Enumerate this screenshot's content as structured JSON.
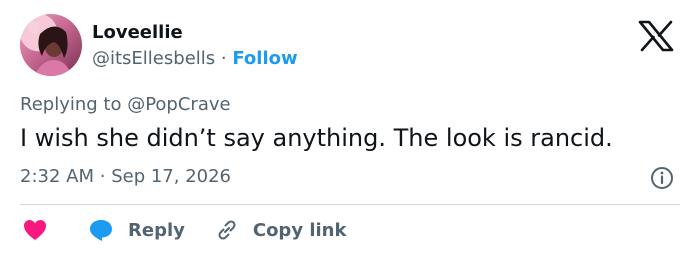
{
  "author": {
    "display_name": "Loveellie",
    "handle": "@itsEllesbells",
    "separator": "·",
    "follow_label": "Follow"
  },
  "tweet": {
    "reply_prefix": "Replying to ",
    "reply_to": "@PopCrave",
    "text": "I wish she didn’t say anything. The look is rancid.",
    "time": "2:32 AM",
    "dot": "·",
    "date": "Sep 17, 2026"
  },
  "actions": {
    "reply_label": "Reply",
    "copy_link_label": "Copy link"
  },
  "icons": {
    "brand": "x-logo-icon",
    "info": "info-icon",
    "like": "heart-icon",
    "reply": "reply-bubble-icon",
    "link": "link-icon"
  },
  "colors": {
    "accent": "#1d9bf0",
    "heart": "#f91880",
    "secondary_text": "#536471",
    "primary_text": "#0f1419",
    "divider": "#cfd9de"
  }
}
